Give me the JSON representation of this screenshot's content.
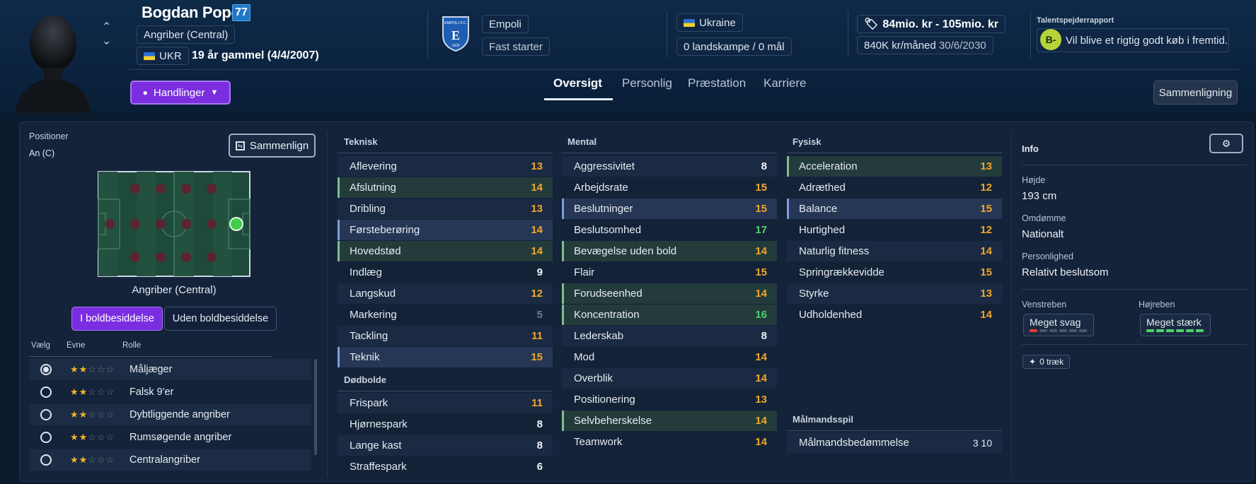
{
  "header": {
    "name": "Bogdan Popov",
    "ca_badge": "77",
    "position": "Angriber (Central)",
    "nation_code": "UKR",
    "age_text": "19 år gammel (4/4/2007)",
    "club": "Empoli",
    "club_logo_text": "EMPOLI F.C.",
    "club_logo_year": "1920",
    "personality_tag": "Fast starter",
    "nation": "Ukraine",
    "caps": "0 landskampe / 0 mål",
    "value_range": "84mio. kr - 105mio. kr",
    "wage": "840K kr/måned",
    "contract_end": "30/6/2030",
    "scout_title": "Talentspejderrapport",
    "scout_grade": "B-",
    "scout_text": "Vil blive et rigtig godt køb i fremtid...",
    "actions_label": "Handlinger",
    "compare_label": "Sammenligning"
  },
  "tabs": [
    "Oversigt",
    "Personlig",
    "Præstation",
    "Karriere"
  ],
  "positions": {
    "title": "Positioner",
    "current": "An (C)",
    "compare_button": "Sammenlign",
    "pitch_label": "Angriber (Central)",
    "toggle_in": "I boldbesiddelse",
    "toggle_out": "Uden boldbesiddelse",
    "col_choose": "Vælg",
    "col_ability": "Evne",
    "col_role": "Rolle",
    "roles": [
      {
        "name": "Målјæger",
        "stars": 2,
        "selected": true
      },
      {
        "name": "Falsk 9'er",
        "stars": 2,
        "selected": false
      },
      {
        "name": "Dybtliggende angriber",
        "stars": 2,
        "selected": false
      },
      {
        "name": "Rumsøgende angriber",
        "stars": 2,
        "selected": false
      },
      {
        "name": "Centralangriber",
        "stars": 2,
        "selected": false
      }
    ]
  },
  "technical": {
    "title": "Teknisk",
    "attrs": [
      {
        "name": "Aflevering",
        "value": "13",
        "color": "orange",
        "hl": ""
      },
      {
        "name": "Afslutning",
        "value": "14",
        "color": "orange",
        "hl": "green"
      },
      {
        "name": "Dribling",
        "value": "13",
        "color": "orange",
        "hl": ""
      },
      {
        "name": "Førsteberøring",
        "value": "14",
        "color": "orange",
        "hl": "blue"
      },
      {
        "name": "Hovedstød",
        "value": "14",
        "color": "orange",
        "hl": "green"
      },
      {
        "name": "Indlæg",
        "value": "9",
        "color": "white",
        "hl": ""
      },
      {
        "name": "Langskud",
        "value": "12",
        "color": "orange",
        "hl": ""
      },
      {
        "name": "Markering",
        "value": "5",
        "color": "grey",
        "hl": ""
      },
      {
        "name": "Tackling",
        "value": "11",
        "color": "orange",
        "hl": ""
      },
      {
        "name": "Teknik",
        "value": "15",
        "color": "orange",
        "hl": "blue"
      }
    ]
  },
  "setpieces": {
    "title": "Dødbolde",
    "attrs": [
      {
        "name": "Frispark",
        "value": "11",
        "color": "orange",
        "hl": ""
      },
      {
        "name": "Hjørnespark",
        "value": "8",
        "color": "white",
        "hl": ""
      },
      {
        "name": "Lange kast",
        "value": "8",
        "color": "white",
        "hl": ""
      },
      {
        "name": "Straffespark",
        "value": "6",
        "color": "white",
        "hl": ""
      }
    ]
  },
  "mental": {
    "title": "Mental",
    "attrs": [
      {
        "name": "Aggressivitet",
        "value": "8",
        "color": "white",
        "hl": ""
      },
      {
        "name": "Arbejdsrate",
        "value": "15",
        "color": "orange",
        "hl": ""
      },
      {
        "name": "Beslutninger",
        "value": "15",
        "color": "orange",
        "hl": "blue"
      },
      {
        "name": "Beslutsomhed",
        "value": "17",
        "color": "green",
        "hl": ""
      },
      {
        "name": "Bevægelse uden bold",
        "value": "14",
        "color": "orange",
        "hl": "green"
      },
      {
        "name": "Flair",
        "value": "15",
        "color": "orange",
        "hl": ""
      },
      {
        "name": "Forudseenhed",
        "value": "14",
        "color": "orange",
        "hl": "green"
      },
      {
        "name": "Koncentration",
        "value": "16",
        "color": "green",
        "hl": "green"
      },
      {
        "name": "Lederskab",
        "value": "8",
        "color": "white",
        "hl": ""
      },
      {
        "name": "Mod",
        "value": "14",
        "color": "orange",
        "hl": ""
      },
      {
        "name": "Overblik",
        "value": "14",
        "color": "orange",
        "hl": ""
      },
      {
        "name": "Positionering",
        "value": "13",
        "color": "orange",
        "hl": ""
      },
      {
        "name": "Selvbeherskelse",
        "value": "14",
        "color": "orange",
        "hl": "green"
      },
      {
        "name": "Teamwork",
        "value": "14",
        "color": "orange",
        "hl": ""
      }
    ]
  },
  "physical": {
    "title": "Fysisk",
    "attrs": [
      {
        "name": "Acceleration",
        "value": "13",
        "color": "orange",
        "hl": "green"
      },
      {
        "name": "Adræthed",
        "value": "12",
        "color": "orange",
        "hl": ""
      },
      {
        "name": "Balance",
        "value": "15",
        "color": "orange",
        "hl": "blue"
      },
      {
        "name": "Hurtighed",
        "value": "12",
        "color": "orange",
        "hl": ""
      },
      {
        "name": "Naturlig fitness",
        "value": "14",
        "color": "orange",
        "hl": ""
      },
      {
        "name": "Springrækkevidde",
        "value": "15",
        "color": "orange",
        "hl": ""
      },
      {
        "name": "Styrke",
        "value": "13",
        "color": "orange",
        "hl": ""
      },
      {
        "name": "Udholdenhed",
        "value": "14",
        "color": "orange",
        "hl": ""
      }
    ]
  },
  "goalkeeping": {
    "title": "Målmandsspil",
    "label": "Målmandsbedømmelse",
    "value": "3 10"
  },
  "info": {
    "title": "Info",
    "height_label": "Højde",
    "height": "193 cm",
    "reputation_label": "Omdømme",
    "reputation": "Nationalt",
    "personality_label": "Personlighed",
    "personality": "Relativt beslutsom",
    "left_foot_label": "Venstreben",
    "left_foot": "Meget svag",
    "left_foot_level": 1,
    "right_foot_label": "Højreben",
    "right_foot": "Meget stærk",
    "right_foot_level": 6,
    "traits": "0 træk"
  }
}
